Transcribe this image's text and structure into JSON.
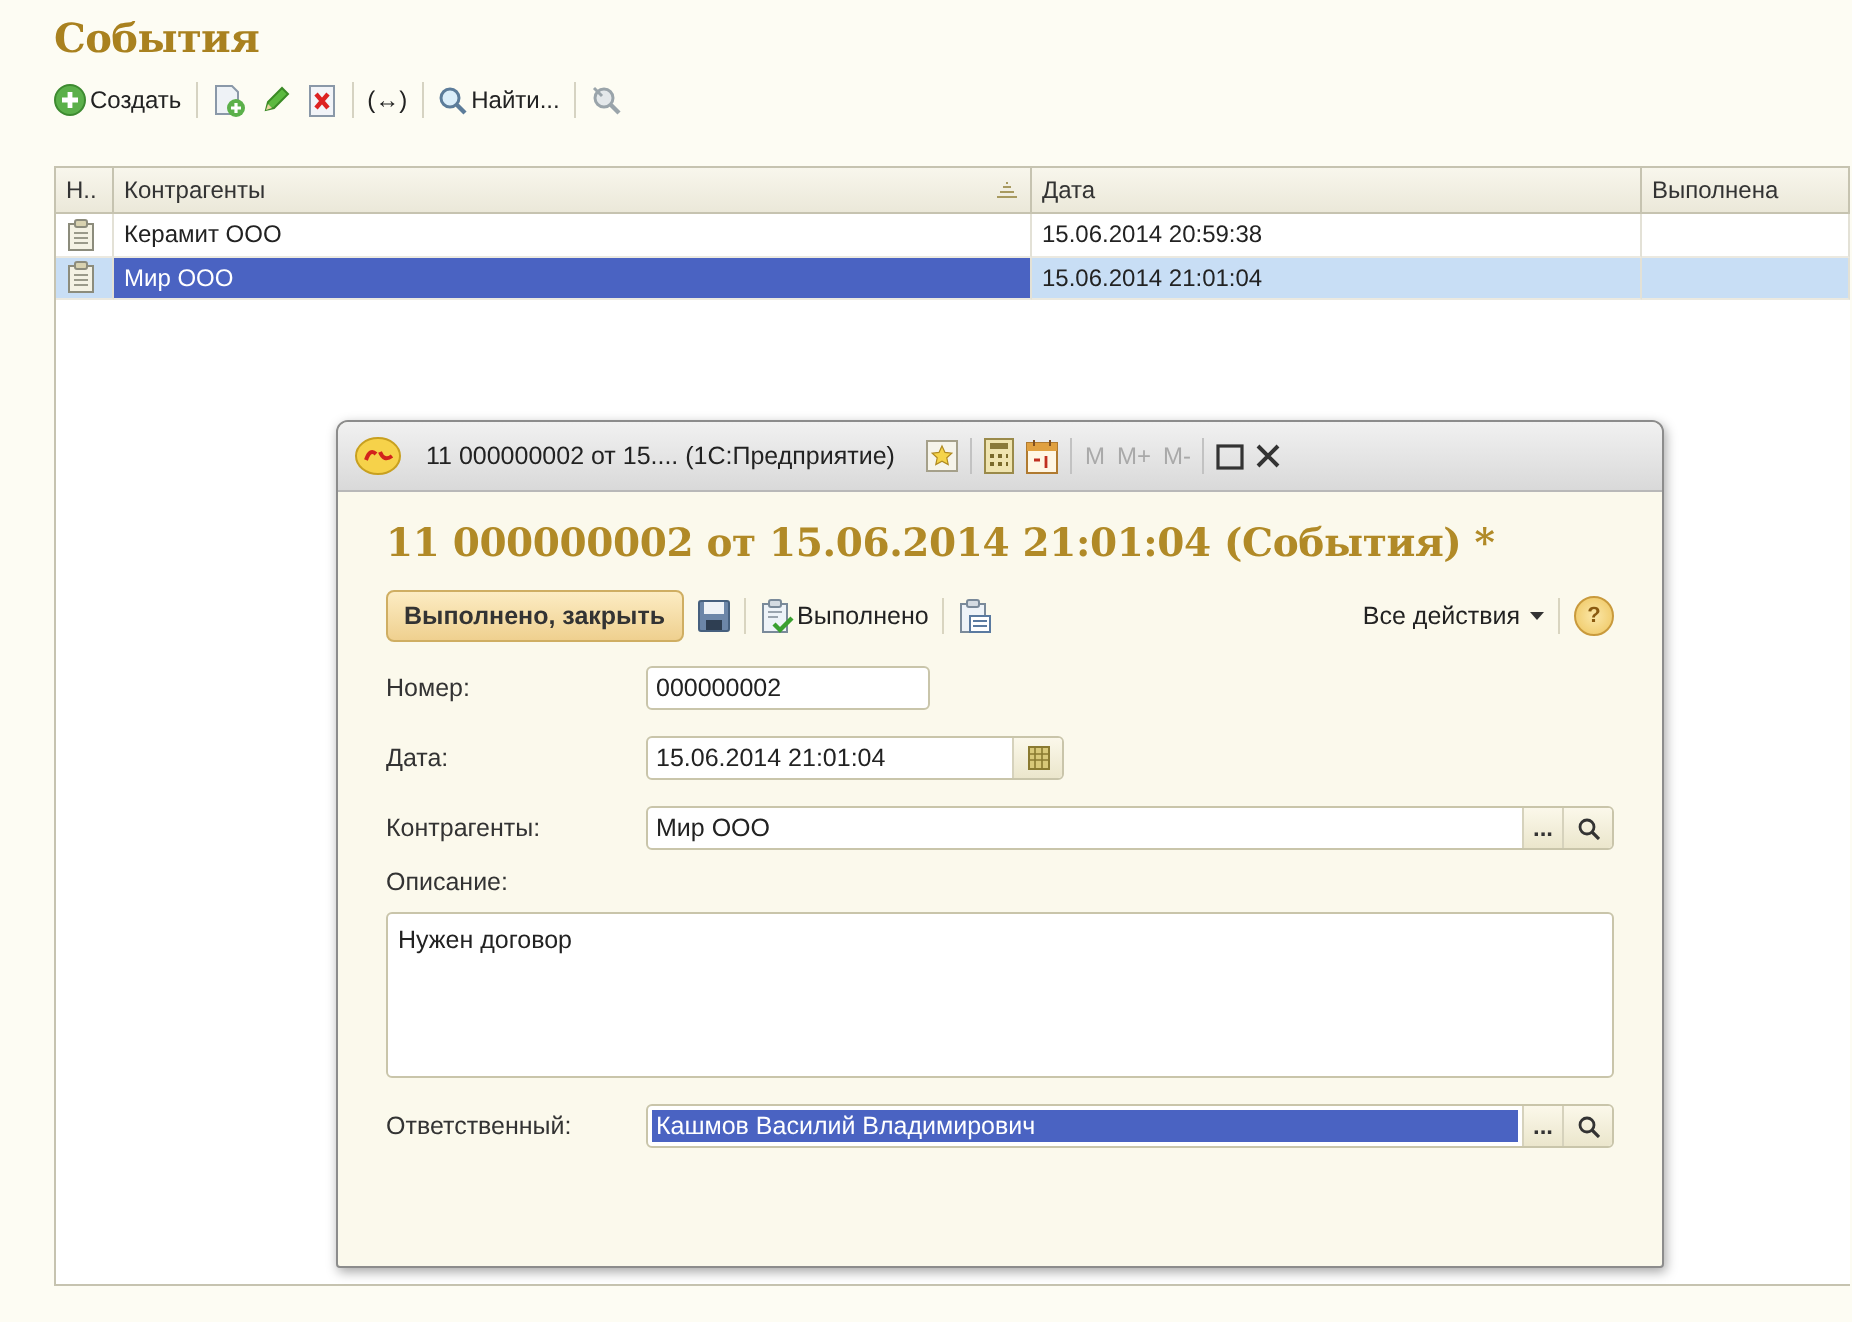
{
  "title": "События",
  "toolbar": {
    "create_button": "Создать",
    "interval_button": "(↔)",
    "find_button": "Найти..."
  },
  "table": {
    "columns": [
      {
        "label": "Н..",
        "sorted": false
      },
      {
        "label": "Контрагенты",
        "sorted": true
      },
      {
        "label": "Дата",
        "sorted": false
      },
      {
        "label": "Выполнена",
        "sorted": false
      }
    ],
    "rows": [
      {
        "counterparty": "Керамит ООО",
        "date": "15.06.2014 20:59:38",
        "selected": false
      },
      {
        "counterparty": "Мир ООО",
        "date": "15.06.2014 21:01:04",
        "selected": true
      }
    ]
  },
  "dialog": {
    "window_title": "11 000000002 от 15.... (1С:Предприятие)",
    "memory_buttons": [
      "M",
      "M+",
      "M-"
    ],
    "heading": "11 000000002 от 15.06.2014 21:01:04 (События) *",
    "toolbar": {
      "primary_button": "Выполнено, закрыть",
      "done_button": "Выполнено",
      "actions_menu": "Все действия",
      "help_button": "?"
    },
    "fields": [
      {
        "kind": "short",
        "label": "Номер:",
        "value": "000000002"
      },
      {
        "kind": "date",
        "label": "Дата:",
        "value": "15.06.2014 21:01:04"
      },
      {
        "kind": "ref",
        "label": "Контрагенты:",
        "value": "Мир ООО",
        "choose_button": "...",
        "selected": false
      },
      {
        "kind": "memo",
        "label": "Описание:",
        "value": "Нужен договор"
      },
      {
        "kind": "ref",
        "label": "Ответственный:",
        "value": "Кашмов Василий Владимирович",
        "choose_button": "...",
        "selected": true
      }
    ]
  }
}
